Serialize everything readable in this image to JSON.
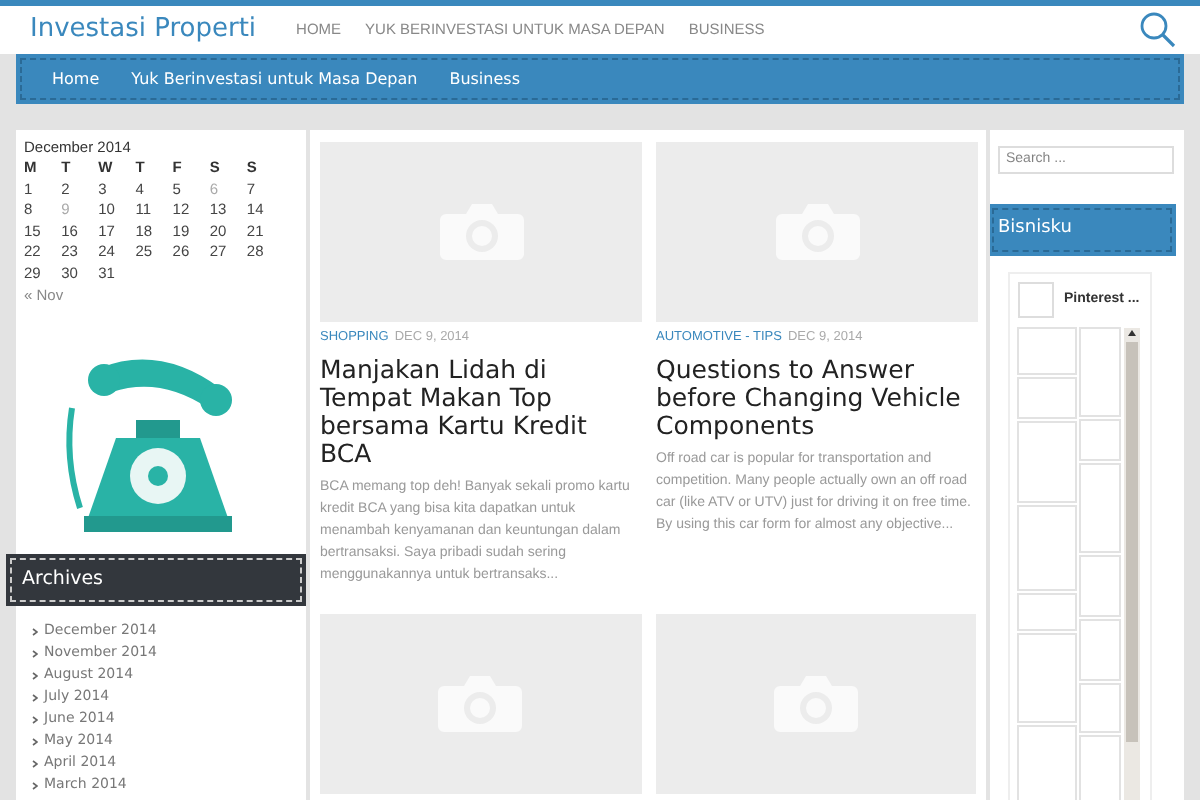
{
  "header": {
    "site_title": "Investasi Properti",
    "nav": [
      "HOME",
      "YUK BERINVESTASI UNTUK MASA DEPAN",
      "BUSINESS"
    ]
  },
  "menu_bar": {
    "items": [
      "Home",
      "Yuk Berinvestasi untuk Masa Depan",
      "Business"
    ]
  },
  "calendar": {
    "caption": "December 2014",
    "weekdays": [
      "M",
      "T",
      "W",
      "T",
      "F",
      "S",
      "S"
    ],
    "weeks": [
      [
        {
          "day": "1",
          "linked": false
        },
        {
          "day": "2",
          "linked": false
        },
        {
          "day": "3",
          "linked": false
        },
        {
          "day": "4",
          "linked": false
        },
        {
          "day": "5",
          "linked": false
        },
        {
          "day": "6",
          "linked": true
        },
        {
          "day": "7",
          "linked": false
        }
      ],
      [
        {
          "day": "8",
          "linked": false
        },
        {
          "day": "9",
          "linked": true
        },
        {
          "day": "10",
          "linked": false
        },
        {
          "day": "11",
          "linked": false
        },
        {
          "day": "12",
          "linked": false
        },
        {
          "day": "13",
          "linked": false
        },
        {
          "day": "14",
          "linked": false
        }
      ],
      [
        {
          "day": "15",
          "linked": false
        },
        {
          "day": "16",
          "linked": false
        },
        {
          "day": "17",
          "linked": false
        },
        {
          "day": "18",
          "linked": false
        },
        {
          "day": "19",
          "linked": false
        },
        {
          "day": "20",
          "linked": false
        },
        {
          "day": "21",
          "linked": false
        }
      ],
      [
        {
          "day": "22",
          "linked": false
        },
        {
          "day": "23",
          "linked": false
        },
        {
          "day": "24",
          "linked": false
        },
        {
          "day": "25",
          "linked": false
        },
        {
          "day": "26",
          "linked": false
        },
        {
          "day": "27",
          "linked": false
        },
        {
          "day": "28",
          "linked": false
        }
      ],
      [
        {
          "day": "29",
          "linked": false
        },
        {
          "day": "30",
          "linked": false
        },
        {
          "day": "31",
          "linked": false
        }
      ]
    ],
    "prev_link": "« Nov"
  },
  "archives": {
    "title": "Archives",
    "items": [
      "December 2014",
      "November 2014",
      "August 2014",
      "July 2014",
      "June 2014",
      "May 2014",
      "April 2014",
      "March 2014"
    ]
  },
  "posts": [
    {
      "category": "SHOPPING",
      "date": "DEC 9, 2014",
      "title": "Manjakan Lidah di Tempat Makan Top bersama Kartu Kredit BCA",
      "excerpt": "BCA memang top deh! Banyak sekali promo kartu kredit BCA yang bisa kita dapatkan untuk menambah kenyamanan dan keuntungan dalam bertransaksi. Saya pribadi sudah sering menggunakannya untuk bertransaks..."
    },
    {
      "category": "AUTOMOTIVE - TIPS",
      "date": "DEC 9, 2014",
      "title": "Questions to Answer before Changing Vehicle Components",
      "excerpt": "Off road car is popular for transportation and competition. Many people actually own an off road car (like ATV or UTV) just for driving it on free time. By using this car form for almost any objective..."
    }
  ],
  "right_sidebar": {
    "search_placeholder": "Search ...",
    "widget_title": "Bisnisku",
    "pinterest_label": "Pinterest ..."
  }
}
